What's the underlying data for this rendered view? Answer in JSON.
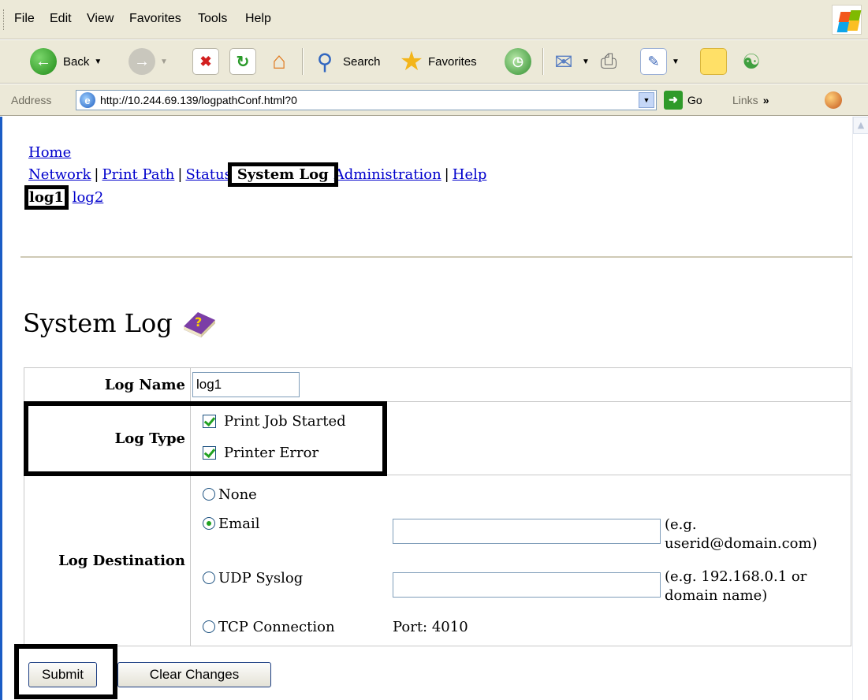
{
  "browser": {
    "menu": [
      "File",
      "Edit",
      "View",
      "Favorites",
      "Tools",
      "Help"
    ],
    "toolbar": {
      "back_label": "Back",
      "search_label": "Search",
      "favorites_label": "Favorites"
    },
    "address_label": "Address",
    "url": "http://10.244.69.139/logpathConf.html?0",
    "go_label": "Go",
    "links_label": "Links",
    "links_chevron": "»"
  },
  "page": {
    "nav": {
      "home": "Home",
      "items": [
        "Network",
        "Print Path",
        "Status",
        "System Log",
        "Administration",
        "Help"
      ],
      "current": "System Log",
      "separator": "|"
    },
    "subnav": {
      "items": [
        "log1",
        "log2"
      ],
      "current": "log1"
    },
    "title": "System Log",
    "title_icon": "help-book-icon",
    "form": {
      "log_name": {
        "label": "Log Name",
        "value": "log1"
      },
      "log_type": {
        "label": "Log Type",
        "options": [
          {
            "label": "Print Job Started",
            "checked": true
          },
          {
            "label": "Printer Error",
            "checked": true
          }
        ]
      },
      "log_destination": {
        "label": "Log Destination",
        "options": [
          {
            "label": "None",
            "selected": false
          },
          {
            "label": "Email",
            "selected": true,
            "value": "",
            "hint": "(e.g. userid@domain.com)"
          },
          {
            "label": "UDP Syslog",
            "selected": false,
            "value": "",
            "hint": "(e.g. 192.168.0.1 or domain name)"
          },
          {
            "label": "TCP Connection",
            "selected": false,
            "port_text": "Port: 4010"
          }
        ]
      }
    },
    "buttons": {
      "submit": "Submit",
      "clear": "Clear Changes"
    },
    "highlight_color": "#000000",
    "link_color": "#0000cc"
  }
}
